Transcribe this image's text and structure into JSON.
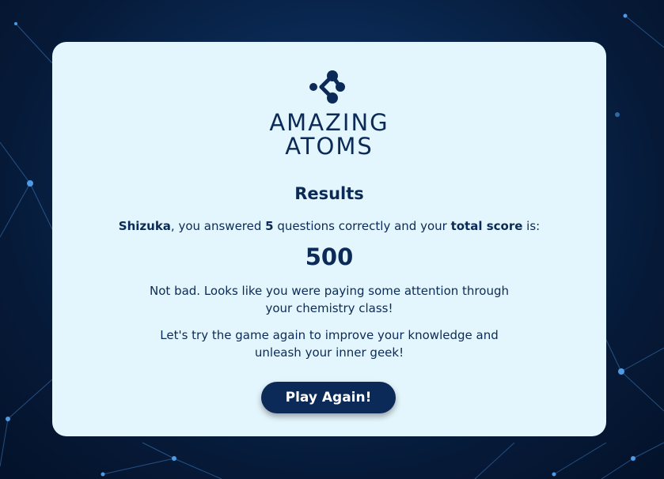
{
  "brand": {
    "icon": "atom-molecule-icon",
    "line1": "AMAZING",
    "line2": "ATOMS"
  },
  "results": {
    "title": "Results",
    "player_name": "Shizuka",
    "text_after_name": ", you answered ",
    "correct_count": "5",
    "text_after_count": " questions correctly and your ",
    "total_score_label": "total score",
    "text_end": " is:",
    "score": "500",
    "feedback_line1": "Not bad. Looks like you were paying some attention through",
    "feedback_line2": "your chemistry class!",
    "encourage_line1": "Let's try the game again to improve your knowledge and",
    "encourage_line2": "unleash your inner geek!",
    "play_again_label": "Play Again!"
  },
  "colors": {
    "card_bg": "#e4f6fd",
    "primary": "#0b2a57",
    "page_bg": "#061a38"
  }
}
